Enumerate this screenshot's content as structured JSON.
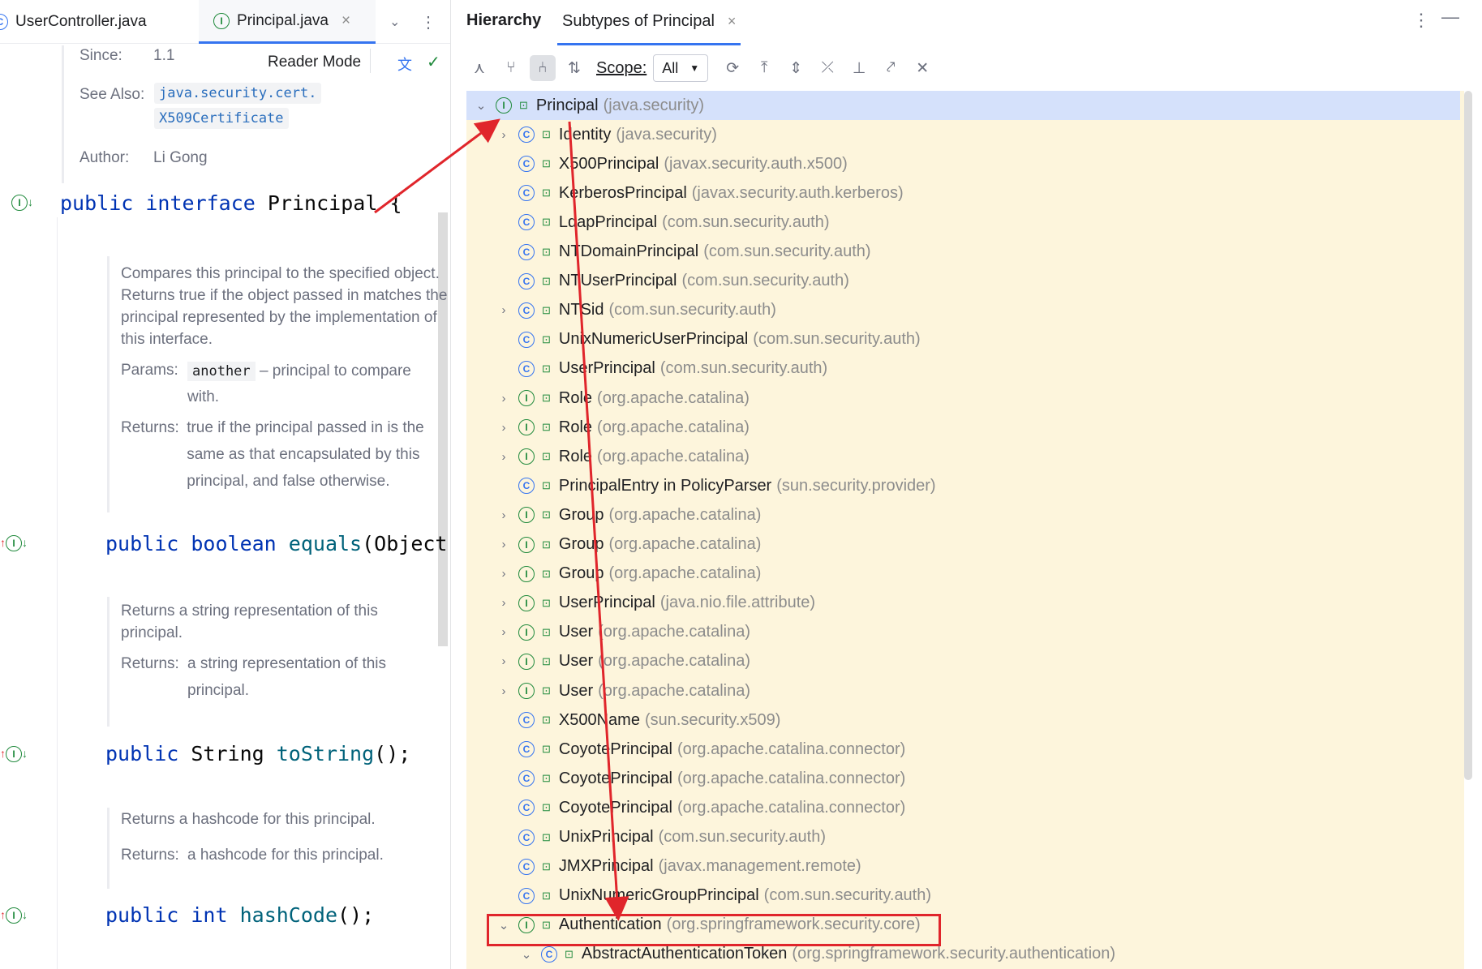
{
  "editor": {
    "tabs": [
      {
        "label": "UserController.java",
        "icon": "class-icon"
      },
      {
        "label": "Principal.java",
        "icon": "interface-icon",
        "close": "×"
      }
    ],
    "reader_mode": "Reader Mode",
    "since_label": "Since:",
    "since_value": "1.1",
    "see_also_label": "See Also:",
    "see_also_1": "java.security.cert.",
    "see_also_2": "X509Certificate",
    "author_label": "Author:",
    "author_value": "Li Gong",
    "decl": {
      "kw1": "public",
      "kw2": "interface",
      "name": "Principal",
      "brace": "{"
    },
    "doc_equals": {
      "text": "Compares this principal to the specified object. Returns true if the object passed in matches the principal represented by the implementation of this interface.",
      "params_label": "Params:",
      "param": "another",
      "param_desc": "– principal to compare with.",
      "returns_label": "Returns:",
      "returns": "true if the principal passed in is the same as that encapsulated by this principal, and false otherwise."
    },
    "equals_sig": {
      "kw1": "public",
      "kw2": "boolean",
      "name": "equals",
      "rest": "(Object ar"
    },
    "doc_tostring": {
      "text": "Returns a string representation of this principal.",
      "returns_label": "Returns:",
      "returns": "a string representation of this principal."
    },
    "tostring_sig": {
      "kw1": "public",
      "type": "String",
      "name": "toString",
      "rest": "();"
    },
    "doc_hashcode": {
      "text": "Returns a hashcode for this principal.",
      "returns_label": "Returns:",
      "returns": "a hashcode for this principal."
    },
    "hashcode_sig": {
      "kw1": "public",
      "kw2": "int",
      "name": "hashCode",
      "rest": "();"
    }
  },
  "hierarchy": {
    "title": "Hierarchy",
    "tab": "Subtypes of Principal",
    "tab_close": "×",
    "scope_label": "Scope:",
    "scope_value": "All",
    "rows": [
      {
        "name": "Principal",
        "pkg": "(java.security)",
        "kind": "I",
        "chevron": "⌄",
        "level": 0
      },
      {
        "name": "Identity",
        "pkg": "(java.security)",
        "kind": "C",
        "chevron": "›",
        "level": 1
      },
      {
        "name": "X500Principal",
        "pkg": "(javax.security.auth.x500)",
        "kind": "C",
        "chevron": "",
        "level": 1
      },
      {
        "name": "KerberosPrincipal",
        "pkg": "(javax.security.auth.kerberos)",
        "kind": "C",
        "chevron": "",
        "level": 1
      },
      {
        "name": "LdapPrincipal",
        "pkg": "(com.sun.security.auth)",
        "kind": "C",
        "chevron": "",
        "level": 1
      },
      {
        "name": "NTDomainPrincipal",
        "pkg": "(com.sun.security.auth)",
        "kind": "C",
        "chevron": "",
        "level": 1
      },
      {
        "name": "NTUserPrincipal",
        "pkg": "(com.sun.security.auth)",
        "kind": "C",
        "chevron": "",
        "level": 1
      },
      {
        "name": "NTSid",
        "pkg": "(com.sun.security.auth)",
        "kind": "C",
        "chevron": "›",
        "level": 1
      },
      {
        "name": "UnixNumericUserPrincipal",
        "pkg": "(com.sun.security.auth)",
        "kind": "C",
        "chevron": "",
        "level": 1
      },
      {
        "name": "UserPrincipal",
        "pkg": "(com.sun.security.auth)",
        "kind": "C",
        "chevron": "",
        "level": 1
      },
      {
        "name": "Role",
        "pkg": "(org.apache.catalina)",
        "kind": "I",
        "chevron": "›",
        "level": 1
      },
      {
        "name": "Role",
        "pkg": "(org.apache.catalina)",
        "kind": "I",
        "chevron": "›",
        "level": 1
      },
      {
        "name": "Role",
        "pkg": "(org.apache.catalina)",
        "kind": "I",
        "chevron": "›",
        "level": 1
      },
      {
        "name": "PrincipalEntry in PolicyParser",
        "pkg": "(sun.security.provider)",
        "kind": "C",
        "chevron": "",
        "level": 1
      },
      {
        "name": "Group",
        "pkg": "(org.apache.catalina)",
        "kind": "I",
        "chevron": "›",
        "level": 1
      },
      {
        "name": "Group",
        "pkg": "(org.apache.catalina)",
        "kind": "I",
        "chevron": "›",
        "level": 1
      },
      {
        "name": "Group",
        "pkg": "(org.apache.catalina)",
        "kind": "I",
        "chevron": "›",
        "level": 1
      },
      {
        "name": "UserPrincipal",
        "pkg": "(java.nio.file.attribute)",
        "kind": "I",
        "chevron": "›",
        "level": 1
      },
      {
        "name": "User",
        "pkg": "(org.apache.catalina)",
        "kind": "I",
        "chevron": "›",
        "level": 1
      },
      {
        "name": "User",
        "pkg": "(org.apache.catalina)",
        "kind": "I",
        "chevron": "›",
        "level": 1
      },
      {
        "name": "User",
        "pkg": "(org.apache.catalina)",
        "kind": "I",
        "chevron": "›",
        "level": 1
      },
      {
        "name": "X500Name",
        "pkg": "(sun.security.x509)",
        "kind": "C",
        "chevron": "",
        "level": 1
      },
      {
        "name": "CoyotePrincipal",
        "pkg": "(org.apache.catalina.connector)",
        "kind": "C",
        "chevron": "",
        "level": 1
      },
      {
        "name": "CoyotePrincipal",
        "pkg": "(org.apache.catalina.connector)",
        "kind": "C",
        "chevron": "",
        "level": 1
      },
      {
        "name": "CoyotePrincipal",
        "pkg": "(org.apache.catalina.connector)",
        "kind": "C",
        "chevron": "",
        "level": 1
      },
      {
        "name": "UnixPrincipal",
        "pkg": "(com.sun.security.auth)",
        "kind": "C",
        "chevron": "",
        "level": 1
      },
      {
        "name": "JMXPrincipal",
        "pkg": "(javax.management.remote)",
        "kind": "C",
        "chevron": "",
        "level": 1
      },
      {
        "name": "UnixNumericGroupPrincipal",
        "pkg": "(com.sun.security.auth)",
        "kind": "C",
        "chevron": "",
        "level": 1
      },
      {
        "name": "Authentication",
        "pkg": "(org.springframework.security.core)",
        "kind": "I",
        "chevron": "⌄",
        "level": 1
      },
      {
        "name": "AbstractAuthenticationToken",
        "pkg": "(org.springframework.security.authentication)",
        "kind": "C",
        "chevron": "⌄",
        "level": 2
      }
    ]
  },
  "annotation_color": "#e0252b"
}
